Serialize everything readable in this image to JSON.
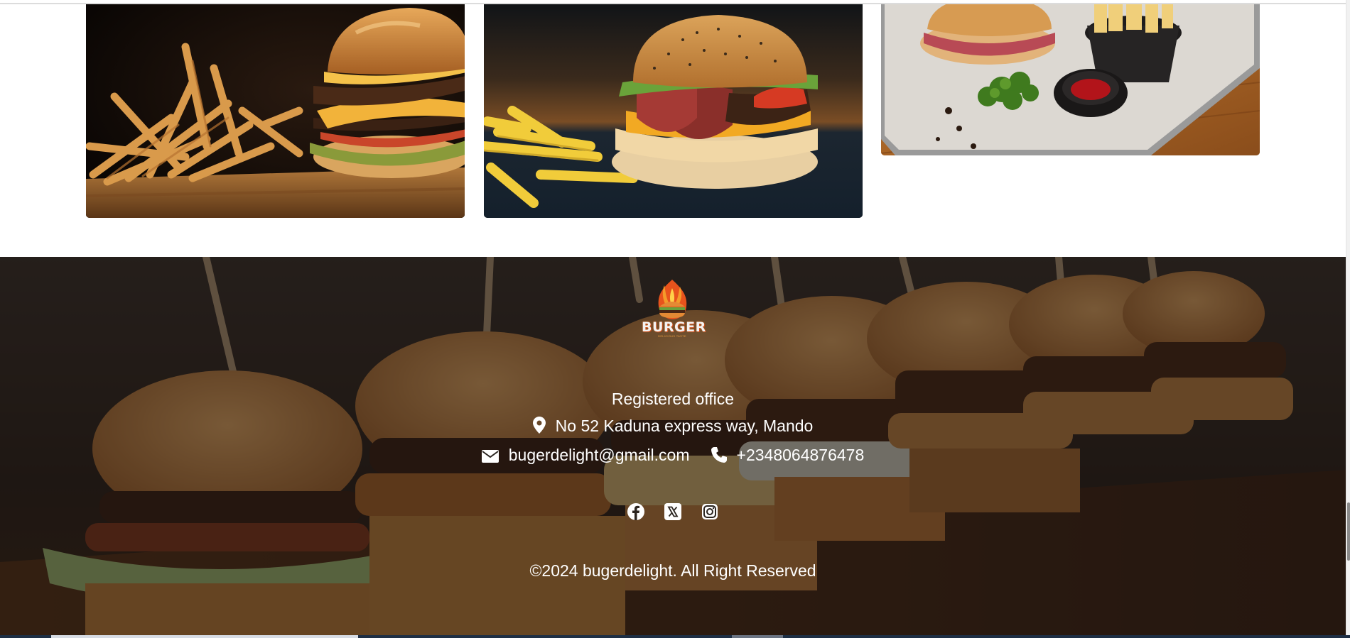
{
  "gallery": {
    "cards": [
      {
        "image": "burger-and-fries-on-wooden-board"
      },
      {
        "image": "bacon-cheeseburger-with-fries-on-slate"
      },
      {
        "image": "burger-fries-and-ketchup-on-tray"
      }
    ]
  },
  "footer": {
    "logo": {
      "text": "BURGER",
      "tagline": "DELICIOUS TASTE",
      "icon": "flaming-burger-logo"
    },
    "office_title": "Registered office",
    "address": {
      "icon": "location-pin-icon",
      "text": "No 52 Kaduna express way, Mando"
    },
    "email": {
      "icon": "envelope-icon",
      "text": "bugerdelight@gmail.com"
    },
    "phone": {
      "icon": "phone-icon",
      "text": "+2348064876478"
    },
    "social": [
      {
        "icon": "facebook-icon"
      },
      {
        "icon": "x-twitter-icon"
      },
      {
        "icon": "instagram-icon"
      }
    ],
    "copyright": "©2024 bugerdelight. All Right Reserved"
  },
  "colors": {
    "footer_text": "#ffffff",
    "footer_overlay": "#140f0c",
    "page_background": "#ffffff"
  }
}
